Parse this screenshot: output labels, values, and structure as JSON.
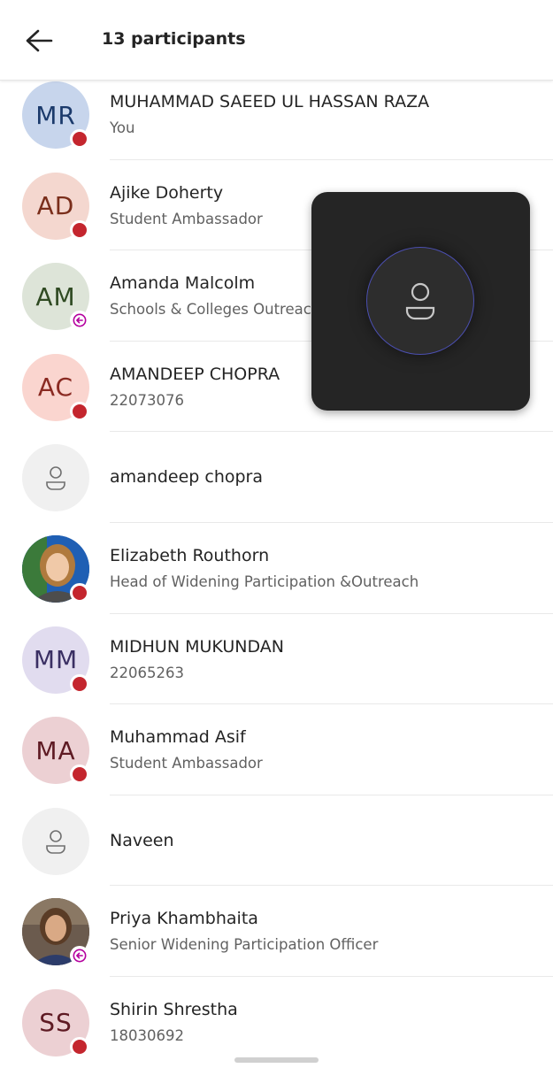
{
  "header": {
    "title": "13 participants",
    "back_icon": "arrow-left-icon"
  },
  "participants": [
    {
      "initials": "MR",
      "name": "MUHAMMAD SAEED UL HASSAN RAZA",
      "subtitle": "You",
      "avatar_bg": "#c7d5ec",
      "avatar_fg": "#1b3a6b",
      "status": "busy"
    },
    {
      "initials": "AD",
      "name": "Ajike Doherty",
      "subtitle": "Student Ambassador",
      "avatar_bg": "#f4d7cf",
      "avatar_fg": "#7a2e1b",
      "status": "busy"
    },
    {
      "initials": "AM",
      "name": "Amanda Malcolm",
      "subtitle": "Schools & Colleges Outreach",
      "avatar_bg": "#dde4d8",
      "avatar_fg": "#2f4a22",
      "status": "away"
    },
    {
      "initials": "AC",
      "name": "AMANDEEP CHOPRA",
      "subtitle": "22073076",
      "avatar_bg": "#fad5cf",
      "avatar_fg": "#8a2a22",
      "status": "busy"
    },
    {
      "initials": "",
      "name": "amandeep chopra",
      "subtitle": "",
      "avatar_bg": "#f0f0f0",
      "avatar_fg": "#616161",
      "status": "none",
      "avatar_icon": "person-icon"
    },
    {
      "initials": "",
      "name": "Elizabeth Routhorn",
      "subtitle": "Head of Widening Participation &Outreach",
      "avatar_bg": "#1f5fb4",
      "avatar_fg": "#ffffff",
      "status": "busy",
      "avatar_icon": "profile-photo"
    },
    {
      "initials": "MM",
      "name": "MIDHUN MUKUNDAN",
      "subtitle": "22065263",
      "avatar_bg": "#e1dcef",
      "avatar_fg": "#3a2f63",
      "status": "busy"
    },
    {
      "initials": "MA",
      "name": "Muhammad Asif",
      "subtitle": "Student Ambassador",
      "avatar_bg": "#ecd0d3",
      "avatar_fg": "#5e1a23",
      "status": "busy"
    },
    {
      "initials": "",
      "name": "Naveen",
      "subtitle": "",
      "avatar_bg": "#f0f0f0",
      "avatar_fg": "#616161",
      "status": "none",
      "avatar_icon": "person-icon"
    },
    {
      "initials": "",
      "name": "Priya Khambhaita",
      "subtitle": "Senior Widening Participation Officer",
      "avatar_bg": "#6b5b4e",
      "avatar_fg": "#ffffff",
      "status": "away",
      "avatar_icon": "profile-photo"
    },
    {
      "initials": "SS",
      "name": "Shirin Shrestha",
      "subtitle": "18030692",
      "avatar_bg": "#ecd0d3",
      "avatar_fg": "#5e1a23",
      "status": "busy"
    }
  ],
  "video_tile": {
    "icon": "person-icon"
  },
  "colors": {
    "busy": "#c4262e",
    "away": "#b4009e"
  }
}
